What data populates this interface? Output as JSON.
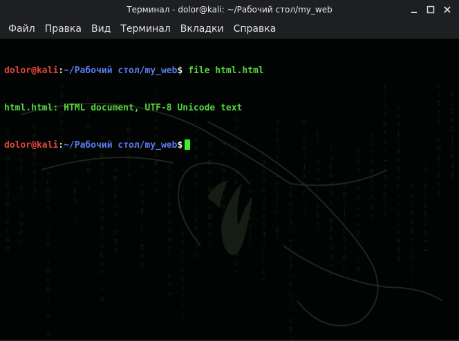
{
  "window": {
    "title": "Терминал - dolor@kali: ~/Рабочий стол/my_web",
    "controls": [
      {
        "name": "minimize",
        "icon": "minimize-icon"
      },
      {
        "name": "maximize",
        "icon": "maximize-icon"
      },
      {
        "name": "close",
        "icon": "close-icon"
      }
    ]
  },
  "menu": {
    "items": [
      "Файл",
      "Правка",
      "Вид",
      "Терминал",
      "Вкладки",
      "Справка"
    ]
  },
  "terminal": {
    "prompt": {
      "user": "dolor",
      "at": "@",
      "host": "kali",
      "colon": ":",
      "path": "~/Рабочий стол/my_web",
      "dollar": "$"
    },
    "lines": [
      {
        "type": "command",
        "text": " file html.html"
      },
      {
        "type": "output",
        "text": "html.html: HTML document, UTF-8 Unicode text"
      },
      {
        "type": "prompt_cursor",
        "text": " "
      }
    ]
  },
  "colors": {
    "background": "#020403",
    "prompt_user": "#e0463c",
    "prompt_path": "#5b7cf0",
    "output_text": "#55d63f",
    "cursor": "#3cf02a",
    "titlebar": "#1e1f22"
  }
}
